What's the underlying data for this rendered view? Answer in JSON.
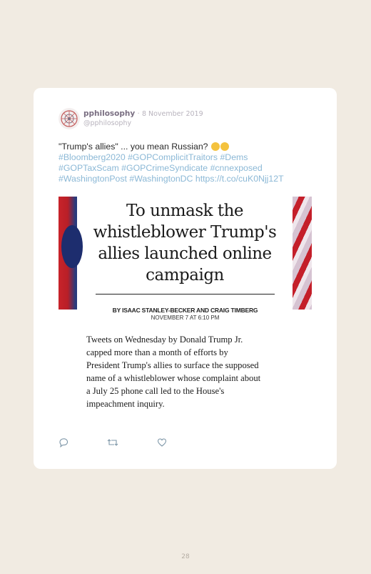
{
  "tweet": {
    "user_name": "pphilosophy",
    "separator": "·",
    "date": "8 November 2019",
    "handle": "@pphilosophy",
    "text_plain": "\"Trump's allies\" ... you mean Russian? ",
    "hashtags": [
      "#Bloomberg2020",
      "#GOPComplicitTraitors",
      "#Dems",
      "#GOPTaxScam",
      "#GOPCrimeSyndicate",
      "#cnnexposed",
      "#WashingtonPost",
      "#WashingtonDC"
    ],
    "link": "https://t.co/cuK0Njj12T",
    "emoji": "thinking-face"
  },
  "media": {
    "headline_lines": [
      "To unmask the",
      "whistleblower Trump's",
      "allies launched online",
      "campaign"
    ],
    "byline": "BY ISAAC STANLEY-BECKER AND CRAIG TIMBERG",
    "dateline": "NOVEMBER 7 AT 6:10 PM",
    "body_lines": [
      "Tweets on Wednesday by Donald Trump Jr.",
      "capped more than a month of efforts by",
      "President Trump's allies to surface the supposed",
      "name of a whistleblower whose complaint about",
      "a July 25 phone call led to the House's",
      "impeachment inquiry."
    ]
  },
  "icons": {
    "reply": "reply-icon",
    "retweet": "retweet-icon",
    "like": "heart-icon"
  },
  "colors": {
    "page_bg": "#f1ebe2",
    "link": "#8bb8d6",
    "name": "#7a6f82"
  },
  "page": {
    "number": "28"
  }
}
